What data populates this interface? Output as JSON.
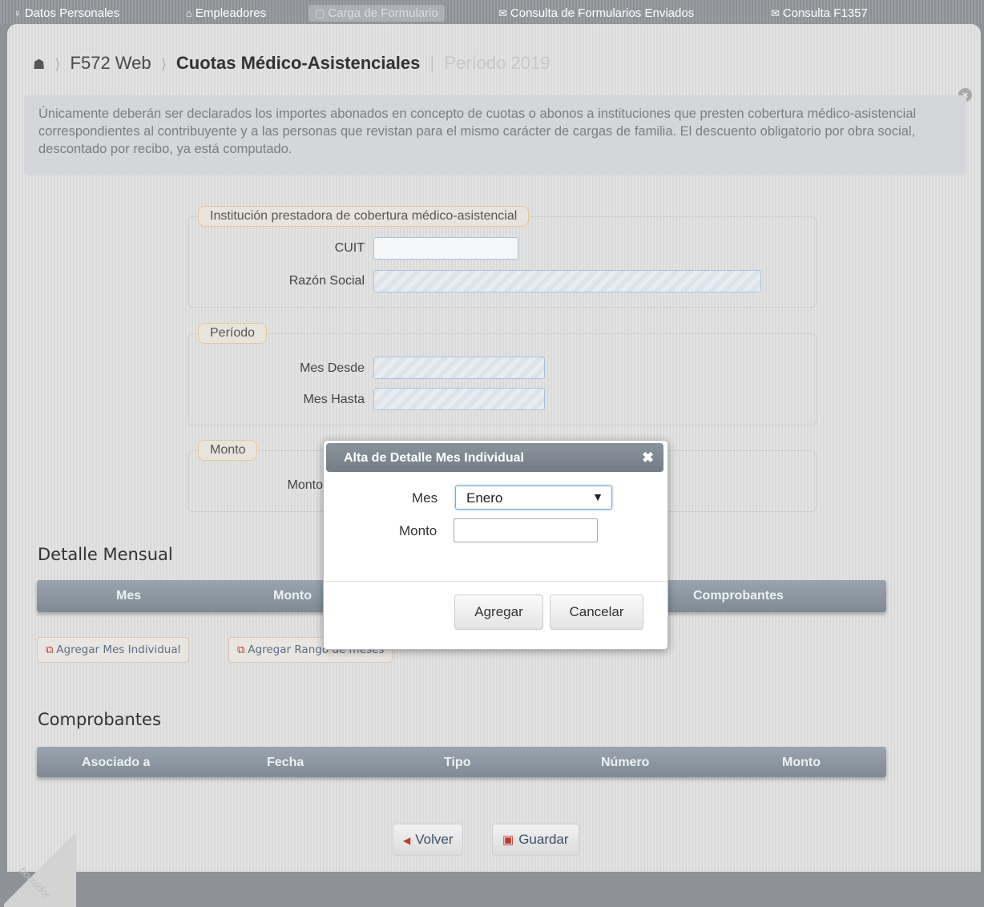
{
  "nav": {
    "items": [
      {
        "icon": "person-icon",
        "glyph": "♀",
        "label": "Datos Personales"
      },
      {
        "icon": "building-icon",
        "glyph": "⌂",
        "label": "Empleadores"
      },
      {
        "icon": "form-icon",
        "glyph": "▢",
        "label": "Carga de Formulario"
      },
      {
        "icon": "mail-icon",
        "glyph": "✉",
        "label": "Consulta de Formularios Enviados"
      },
      {
        "icon": "mail-icon",
        "glyph": "✉",
        "label": "Consulta F1357"
      }
    ]
  },
  "breadcrumb": {
    "root": "F572 Web",
    "current": "Cuotas Médico-Asistenciales",
    "period": "Período 2019"
  },
  "info": {
    "text": "Únicamente deberán ser declarados los importes abonados en concepto de cuotas o abonos a instituciones que presten cobertura médico-asistencial correspondientes al contribuyente y a las personas que revistan para el mismo carácter de cargas de familia. El descuento obligatorio por obra social, descontado por recibo, ya está computado."
  },
  "institucion": {
    "legend": "Institución prestadora de cobertura médico-asistencial",
    "cuit_label": "CUIT",
    "razon_label": "Razón Social"
  },
  "periodo": {
    "legend": "Período",
    "desde_label": "Mes Desde",
    "hasta_label": "Mes Hasta"
  },
  "monto": {
    "legend": "Monto",
    "label": "Monto"
  },
  "detalle": {
    "title": "Detalle Mensual",
    "columns": [
      "Mes",
      "Monto",
      "Comprobantes"
    ],
    "add_individual": "Agregar Mes Individual",
    "add_rango": "Agregar Rango de meses"
  },
  "comprobantes": {
    "title": "Comprobantes",
    "columns": [
      "Asociado a",
      "Fecha",
      "Tipo",
      "Número",
      "Monto"
    ]
  },
  "actions": {
    "volver": "Volver",
    "guardar": "Guardar"
  },
  "watermark": "borrador",
  "dialog": {
    "title": "Alta de Detalle Mes Individual",
    "mes_label": "Mes",
    "mes_value": "Enero",
    "monto_label": "Monto",
    "monto_value": "",
    "agregar": "Agregar",
    "cancelar": "Cancelar"
  }
}
